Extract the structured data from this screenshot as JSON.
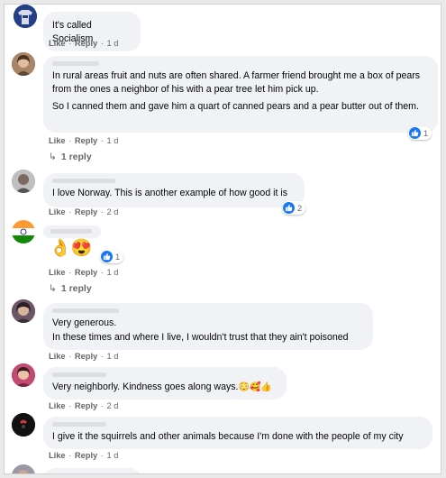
{
  "colors": {
    "accent": "#1877f2",
    "bubble": "#f0f2f5",
    "meta_text": "#65676b"
  },
  "comments": [
    {
      "text": [
        "It's called Socialism"
      ],
      "like": "Like",
      "reply": "Reply",
      "time": "1 d"
    },
    {
      "text": [
        "In rural areas fruit and nuts are often shared. A farmer friend brought me a box of pears from the ones a neighbor of his with a pear tree let him pick up.",
        "So I canned them and gave him a quart of canned pears and a pear butter out of them."
      ],
      "like": "Like",
      "reply": "Reply",
      "time": "1 d",
      "reactions": "1",
      "replies": "1 reply"
    },
    {
      "text": [
        "I love Norway. This is another example of how good it is"
      ],
      "like": "Like",
      "reply": "Reply",
      "time": "2 d",
      "reactions": "2"
    },
    {
      "emojis": "👌😍",
      "like": "Like",
      "reply": "Reply",
      "time": "1 d",
      "reactions": "1",
      "replies": "1 reply"
    },
    {
      "text": [
        "Very generous.",
        "In these times and where I live, I wouldn't trust that they ain't poisoned"
      ],
      "like": "Like",
      "reply": "Reply",
      "time": "1 d"
    },
    {
      "text": [
        "Very neighborly. Kindness goes along ways."
      ],
      "trailing_emojis": "😳🥰👍",
      "like": "Like",
      "reply": "Reply",
      "time": "2 d"
    },
    {
      "text": [
        "I give it the squirrels and other animals because I'm done with the people of my city"
      ],
      "like": "Like",
      "reply": "Reply",
      "time": "1 d"
    }
  ]
}
